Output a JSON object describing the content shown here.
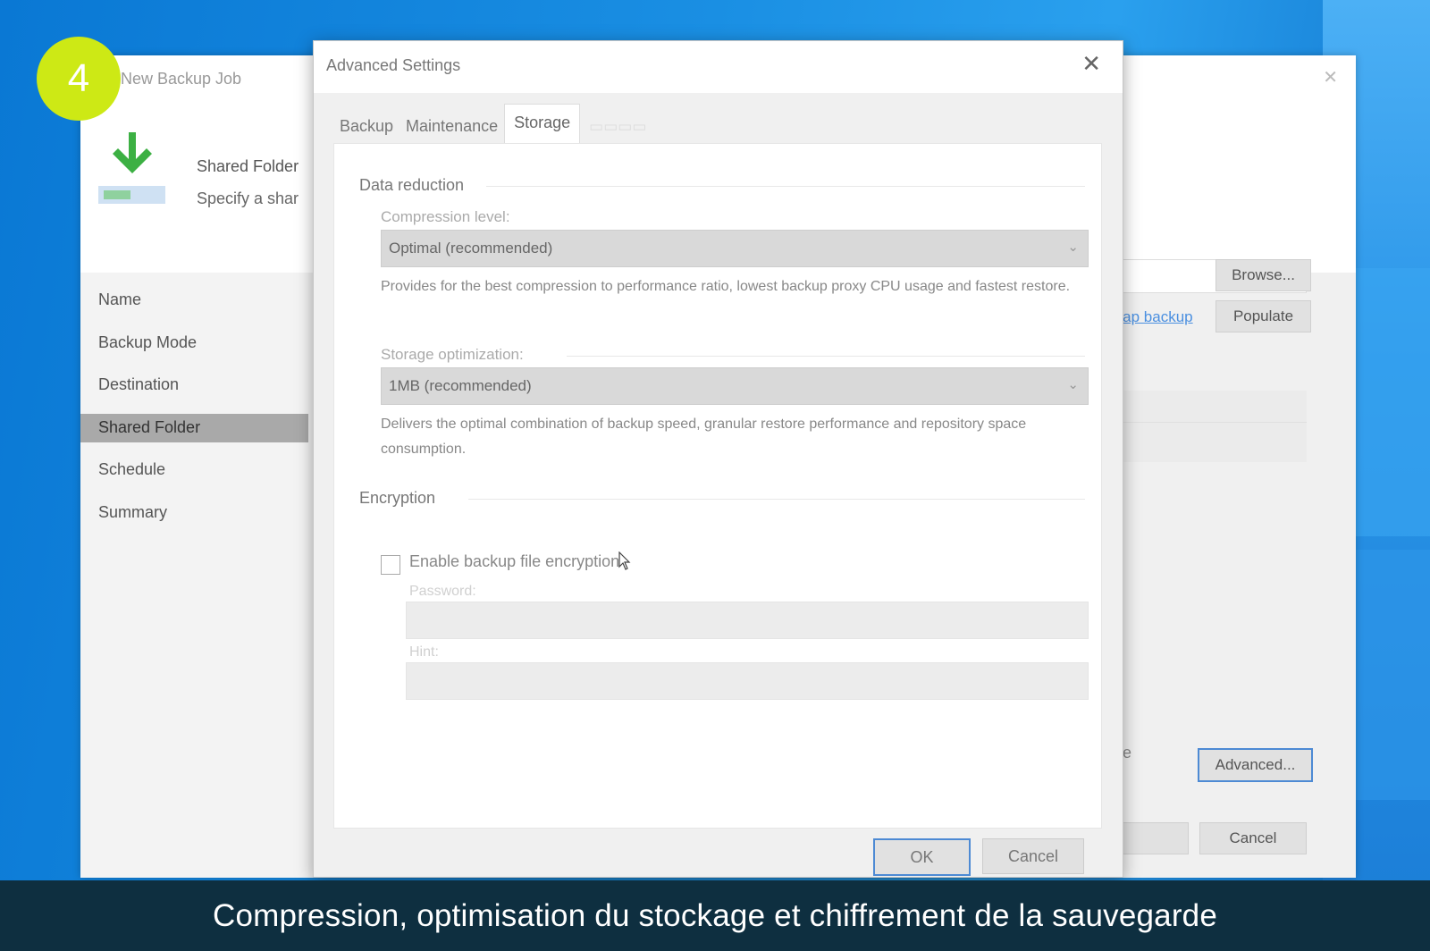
{
  "step_number": "4",
  "caption": "Compression, optimisation du stockage et chiffrement de la sauvegarde",
  "wizard": {
    "title": "New Backup Job",
    "header_title": "Shared Folder",
    "header_subtitle": "Specify a shar",
    "nav": [
      "Name",
      "Backup Mode",
      "Destination",
      "Shared Folder",
      "Schedule",
      "Summary"
    ],
    "selected_nav": "Shared Folder",
    "browse_label": "Browse...",
    "map_backup_label": "Map backup",
    "populate_label": "Populate",
    "backup_file_tail": "p file",
    "advanced_label": "Advanced...",
    "cancel_label": "Cancel"
  },
  "dialog": {
    "title": "Advanced Settings",
    "tabs": [
      "Backup",
      "Maintenance",
      "Storage"
    ],
    "active_tab": "Storage",
    "data_reduction": {
      "group_label": "Data reduction",
      "compression_label": "Compression level:",
      "compression_value": "Optimal (recommended)",
      "compression_desc": "Provides for the best compression to performance ratio, lowest backup proxy CPU usage and fastest restore.",
      "storage_label": "Storage optimization:",
      "storage_value": "1MB (recommended)",
      "storage_desc": "Delivers the optimal combination of backup speed, granular restore performance and repository space consumption."
    },
    "encryption": {
      "group_label": "Encryption",
      "checkbox_label": "Enable backup file encryption",
      "checked": false,
      "password_label": "Password:",
      "hint_label": "Hint:"
    },
    "ok_label": "OK",
    "cancel_label": "Cancel"
  },
  "colors": {
    "badge": "#cde915",
    "caption_bar": "#0e2f40",
    "link": "#4a8fe0",
    "focus_border": "#4d8ad4"
  }
}
